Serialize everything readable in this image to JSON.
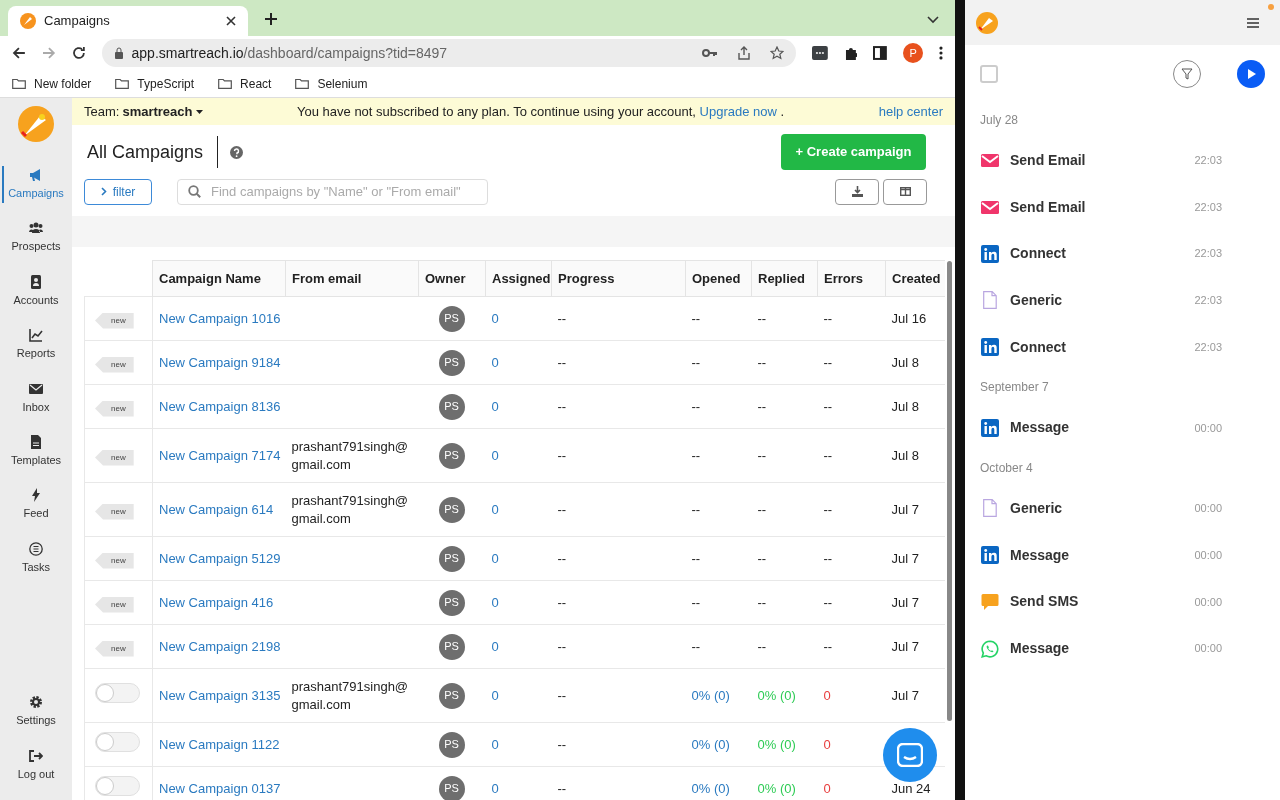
{
  "browser": {
    "tab_title": "Campaigns",
    "url_host": "app.smartreach.io",
    "url_path": "/dashboard/campaigns?tid=8497",
    "profile_initial": "P",
    "bookmarks": [
      "New folder",
      "TypeScript",
      "React",
      "Selenium"
    ]
  },
  "banner": {
    "team_label": "Team:",
    "team_name": "smartreach",
    "message": "You have not subscribed to any plan. To continue using your account,",
    "link": "Upgrade now",
    "after": ".",
    "help": "help center"
  },
  "sidebar": {
    "items": [
      {
        "label": "Campaigns",
        "kind": "megaphone",
        "selected": true
      },
      {
        "label": "Prospects",
        "kind": "people",
        "selected": false
      },
      {
        "label": "Accounts",
        "kind": "card",
        "selected": false
      },
      {
        "label": "Reports",
        "kind": "chart",
        "selected": false
      },
      {
        "label": "Inbox",
        "kind": "mail",
        "selected": false
      },
      {
        "label": "Templates",
        "kind": "doc",
        "selected": false
      },
      {
        "label": "Feed",
        "kind": "bolt",
        "selected": false
      },
      {
        "label": "Tasks",
        "kind": "list",
        "selected": false
      }
    ],
    "bottom": [
      {
        "label": "Settings",
        "kind": "gear"
      },
      {
        "label": "Log out",
        "kind": "logout"
      }
    ]
  },
  "page": {
    "title": "All Campaigns",
    "create_button": "+ Create campaign",
    "filter_button": "filter",
    "search": {
      "placeholder": "Find campaigns by \"Name\" or \"From email\""
    }
  },
  "table": {
    "columns": [
      "Campaign Name",
      "From email",
      "Owner",
      "Assigned",
      "Progress",
      "Opened",
      "Replied",
      "Errors",
      "Created"
    ],
    "rows": [
      {
        "kind": "new",
        "tag": "new",
        "name": "New Campaign 1016",
        "owner": "PS",
        "assigned": "0",
        "progress": "--",
        "opened": "--",
        "replied": "--",
        "errors": "--",
        "created": "Jul 16"
      },
      {
        "kind": "new",
        "tag": "new",
        "name": "New Campaign 9184",
        "owner": "PS",
        "assigned": "0",
        "progress": "--",
        "opened": "--",
        "replied": "--",
        "errors": "--",
        "created": "Jul 8"
      },
      {
        "kind": "new",
        "tag": "new",
        "name": "New Campaign 8136",
        "owner": "PS",
        "assigned": "0",
        "progress": "--",
        "opened": "--",
        "replied": "--",
        "errors": "--",
        "created": "Jul 8"
      },
      {
        "kind": "new",
        "tag": "new",
        "name": "New Campaign 7174",
        "email": "prashant791singh@gmail.com",
        "owner": "PS",
        "assigned": "0",
        "progress": "--",
        "opened": "--",
        "replied": "--",
        "errors": "--",
        "created": "Jul 8"
      },
      {
        "kind": "new",
        "tag": "new",
        "name": "New Campaign 614",
        "email": "prashant791singh@gmail.com",
        "owner": "PS",
        "assigned": "0",
        "progress": "--",
        "opened": "--",
        "replied": "--",
        "errors": "--",
        "created": "Jul 7"
      },
      {
        "kind": "new",
        "tag": "new",
        "name": "New Campaign 5129",
        "owner": "PS",
        "assigned": "0",
        "progress": "--",
        "opened": "--",
        "replied": "--",
        "errors": "--",
        "created": "Jul 7"
      },
      {
        "kind": "new",
        "tag": "new",
        "name": "New Campaign 416",
        "owner": "PS",
        "assigned": "0",
        "progress": "--",
        "opened": "--",
        "replied": "--",
        "errors": "--",
        "created": "Jul 7"
      },
      {
        "kind": "new",
        "tag": "new",
        "name": "New Campaign 2198",
        "owner": "PS",
        "assigned": "0",
        "progress": "--",
        "opened": "--",
        "replied": "--",
        "errors": "--",
        "created": "Jul 7"
      },
      {
        "kind": "toggle",
        "on": false,
        "name": "New Campaign 3135",
        "email": "prashant791singh@gmail.com",
        "owner": "PS",
        "assigned": "0",
        "progress": "--",
        "opened": "0% (0)",
        "replied": "0% (0)",
        "errors": "0",
        "created": "Jul 7"
      },
      {
        "kind": "toggle",
        "on": false,
        "name": "New Campaign 1122",
        "owner": "PS",
        "assigned": "0",
        "progress": "--",
        "opened": "0% (0)",
        "replied": "0% (0)",
        "errors": "0"
      },
      {
        "kind": "toggle",
        "on": false,
        "name": "New Campaign 0137",
        "owner": "PS",
        "assigned": "0",
        "progress": "--",
        "opened": "0% (0)",
        "replied": "0% (0)",
        "errors": "0",
        "created": "Jun 24"
      }
    ]
  },
  "panel": {
    "select_all": {
      "checked": false
    },
    "groups": [
      {
        "date": "July 28",
        "items": [
          {
            "kind": "email",
            "label": "Send Email",
            "time": "22:03"
          },
          {
            "kind": "email",
            "label": "Send Email",
            "time": "22:03"
          },
          {
            "kind": "linkedin",
            "label": "Connect",
            "time": "22:03"
          },
          {
            "kind": "generic",
            "label": "Generic",
            "time": "22:03"
          },
          {
            "kind": "linkedin",
            "label": "Connect",
            "time": "22:03"
          }
        ]
      },
      {
        "date": "September 7",
        "items": [
          {
            "kind": "linkedin",
            "label": "Message",
            "time": "00:00"
          }
        ]
      },
      {
        "date": "October 4",
        "items": [
          {
            "kind": "generic",
            "label": "Generic",
            "time": "00:00"
          },
          {
            "kind": "linkedin",
            "label": "Message",
            "time": "00:00"
          },
          {
            "kind": "sms",
            "label": "Send SMS",
            "time": "00:00"
          },
          {
            "kind": "whatsapp",
            "label": "Message",
            "time": "00:00"
          }
        ]
      }
    ]
  }
}
